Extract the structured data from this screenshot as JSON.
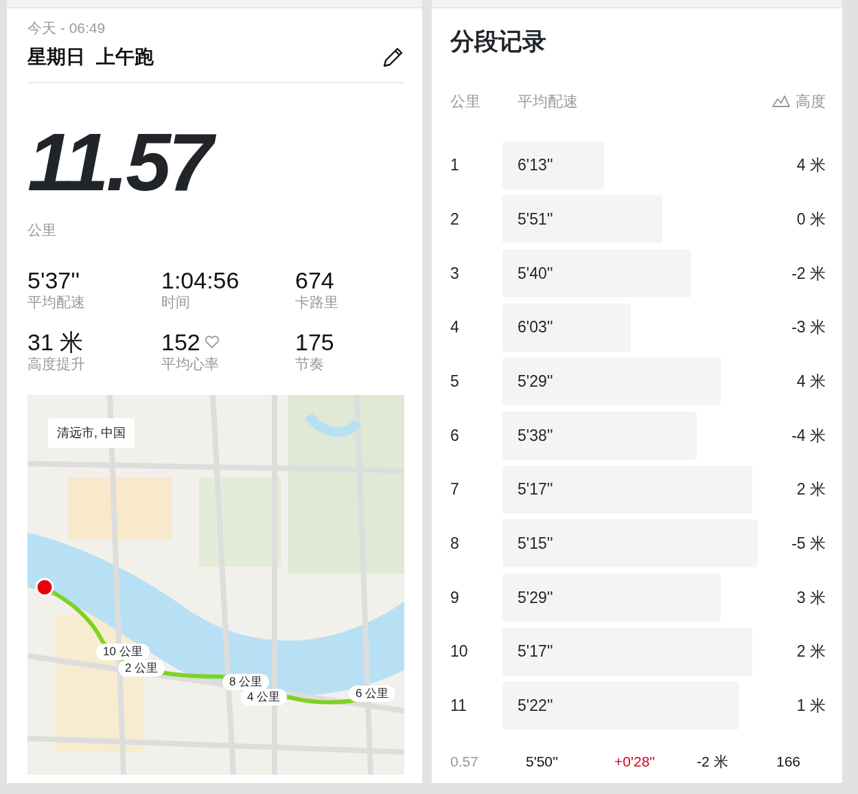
{
  "activity": {
    "date": "今天 - 06:49",
    "title": "星期日  上午跑",
    "distance": "11.57",
    "distance_unit": "公里",
    "stats": [
      {
        "value": "5'37''",
        "label": "平均配速"
      },
      {
        "value": "1:04:56",
        "label": "时间"
      },
      {
        "value": "674",
        "label": "卡路里"
      },
      {
        "value": "31 米",
        "label": "高度提升"
      },
      {
        "value": "152",
        "label": "平均心率",
        "kind": "heart"
      },
      {
        "value": "175",
        "label": "节奏"
      }
    ],
    "map": {
      "kind": "picture",
      "location": "清远市, 中国",
      "markers": [
        "10 公里",
        "2 公里",
        "8 公里",
        "4 公里",
        "6 公里"
      ]
    }
  },
  "splits": {
    "title": "分段记录",
    "columns": [
      "公里",
      "平均配速",
      "高度"
    ],
    "rows": [
      {
        "km": "1",
        "pace": "6'13''",
        "elevation": "4 米"
      },
      {
        "km": "2",
        "pace": "5'51''",
        "elevation": "0 米"
      },
      {
        "km": "3",
        "pace": "5'40''",
        "elevation": "-2 米"
      },
      {
        "km": "4",
        "pace": "6'03''",
        "elevation": "-3 米"
      },
      {
        "km": "5",
        "pace": "5'29''",
        "elevation": "4 米"
      },
      {
        "km": "6",
        "pace": "5'38''",
        "elevation": "-4 米"
      },
      {
        "km": "7",
        "pace": "5'17''",
        "elevation": "2 米"
      },
      {
        "km": "8",
        "pace": "5'15''",
        "elevation": "-5 米"
      },
      {
        "km": "9",
        "pace": "5'29''",
        "elevation": "3 米"
      },
      {
        "km": "10",
        "pace": "5'17''",
        "elevation": "2 米"
      },
      {
        "km": "11",
        "pace": "5'22''",
        "elevation": "1 米"
      }
    ],
    "last": [
      {
        "kind": "distance",
        "text": "0.57"
      },
      {
        "kind": "pace",
        "text": "5'50''"
      },
      {
        "kind": "delta",
        "text": "+0'28''"
      },
      {
        "kind": "elevation",
        "text": "-2 米"
      },
      {
        "kind": "cadence",
        "text": "166"
      }
    ]
  }
}
